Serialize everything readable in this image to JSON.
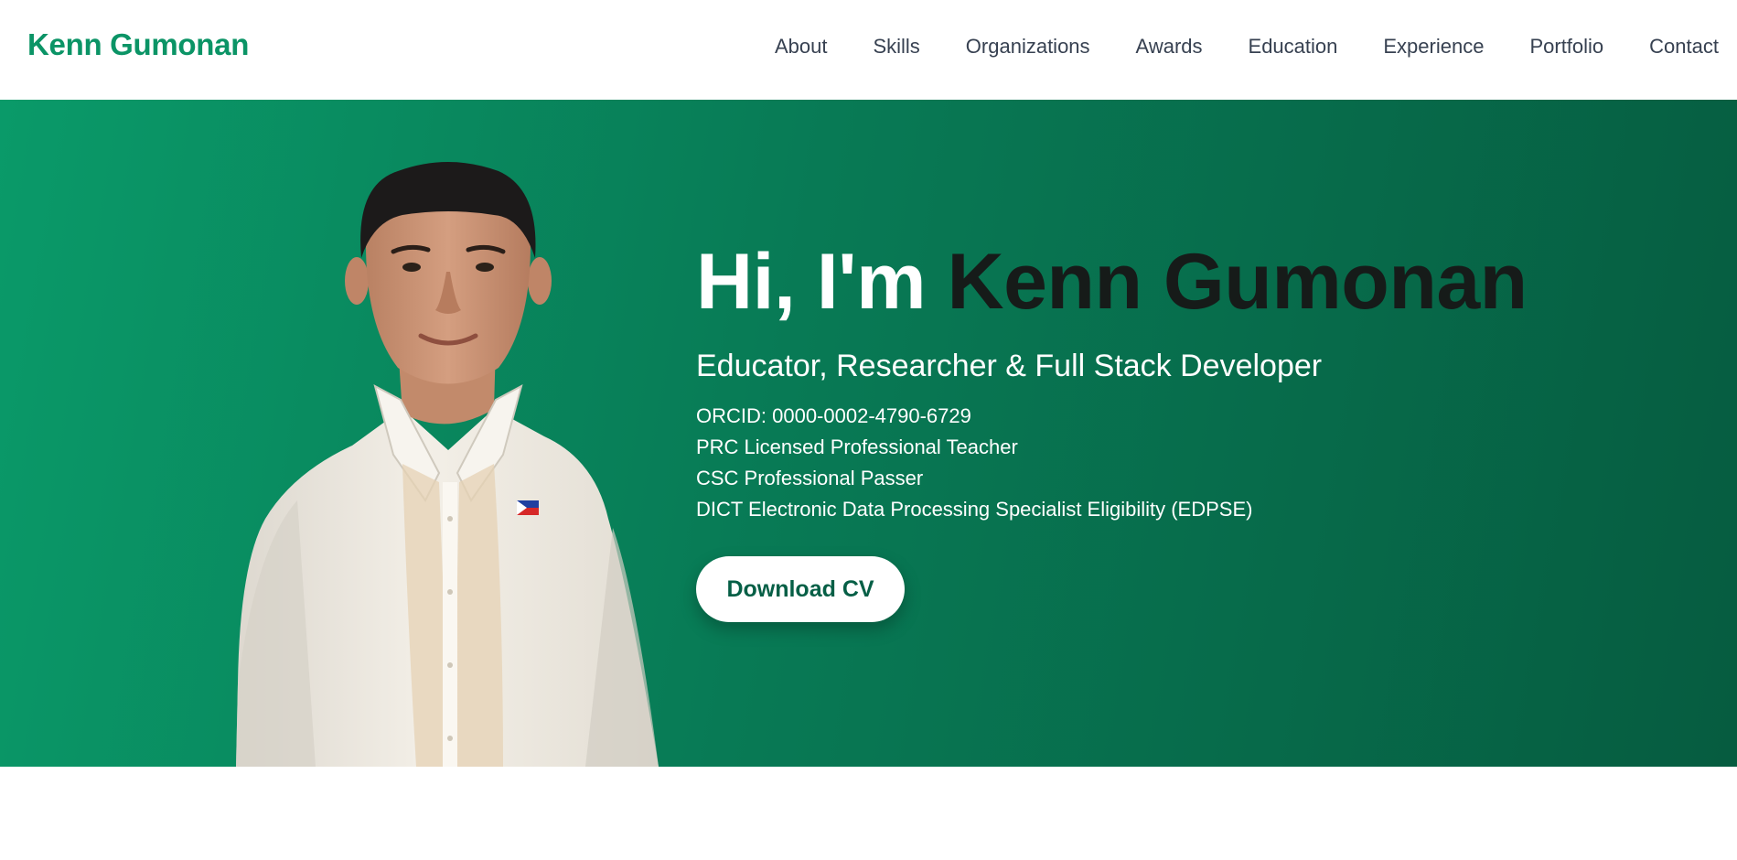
{
  "header": {
    "logo": "Kenn Gumonan",
    "nav": [
      "About",
      "Skills",
      "Organizations",
      "Awards",
      "Education",
      "Experience",
      "Portfolio",
      "Contact"
    ]
  },
  "hero": {
    "greeting_prefix": "Hi, I'm ",
    "name": "Kenn Gumonan",
    "subtitle": "Educator, Researcher & Full Stack Developer",
    "credentials": [
      "ORCID: 0000-0002-4790-6729",
      "PRC Licensed Professional Teacher",
      "CSC Professional Passer",
      "DICT Electronic Data Processing Specialist Eligibility (EDPSE)"
    ],
    "cta_label": "Download CV"
  },
  "colors": {
    "brand_green": "#0b9466",
    "hero_gradient_start": "#0a9a69",
    "hero_gradient_end": "#065c40",
    "name_dark": "#161b19",
    "nav_text": "#374151"
  },
  "icons": {
    "portrait": "profile-photo",
    "flag_pin": "philippine-flag-pin"
  }
}
